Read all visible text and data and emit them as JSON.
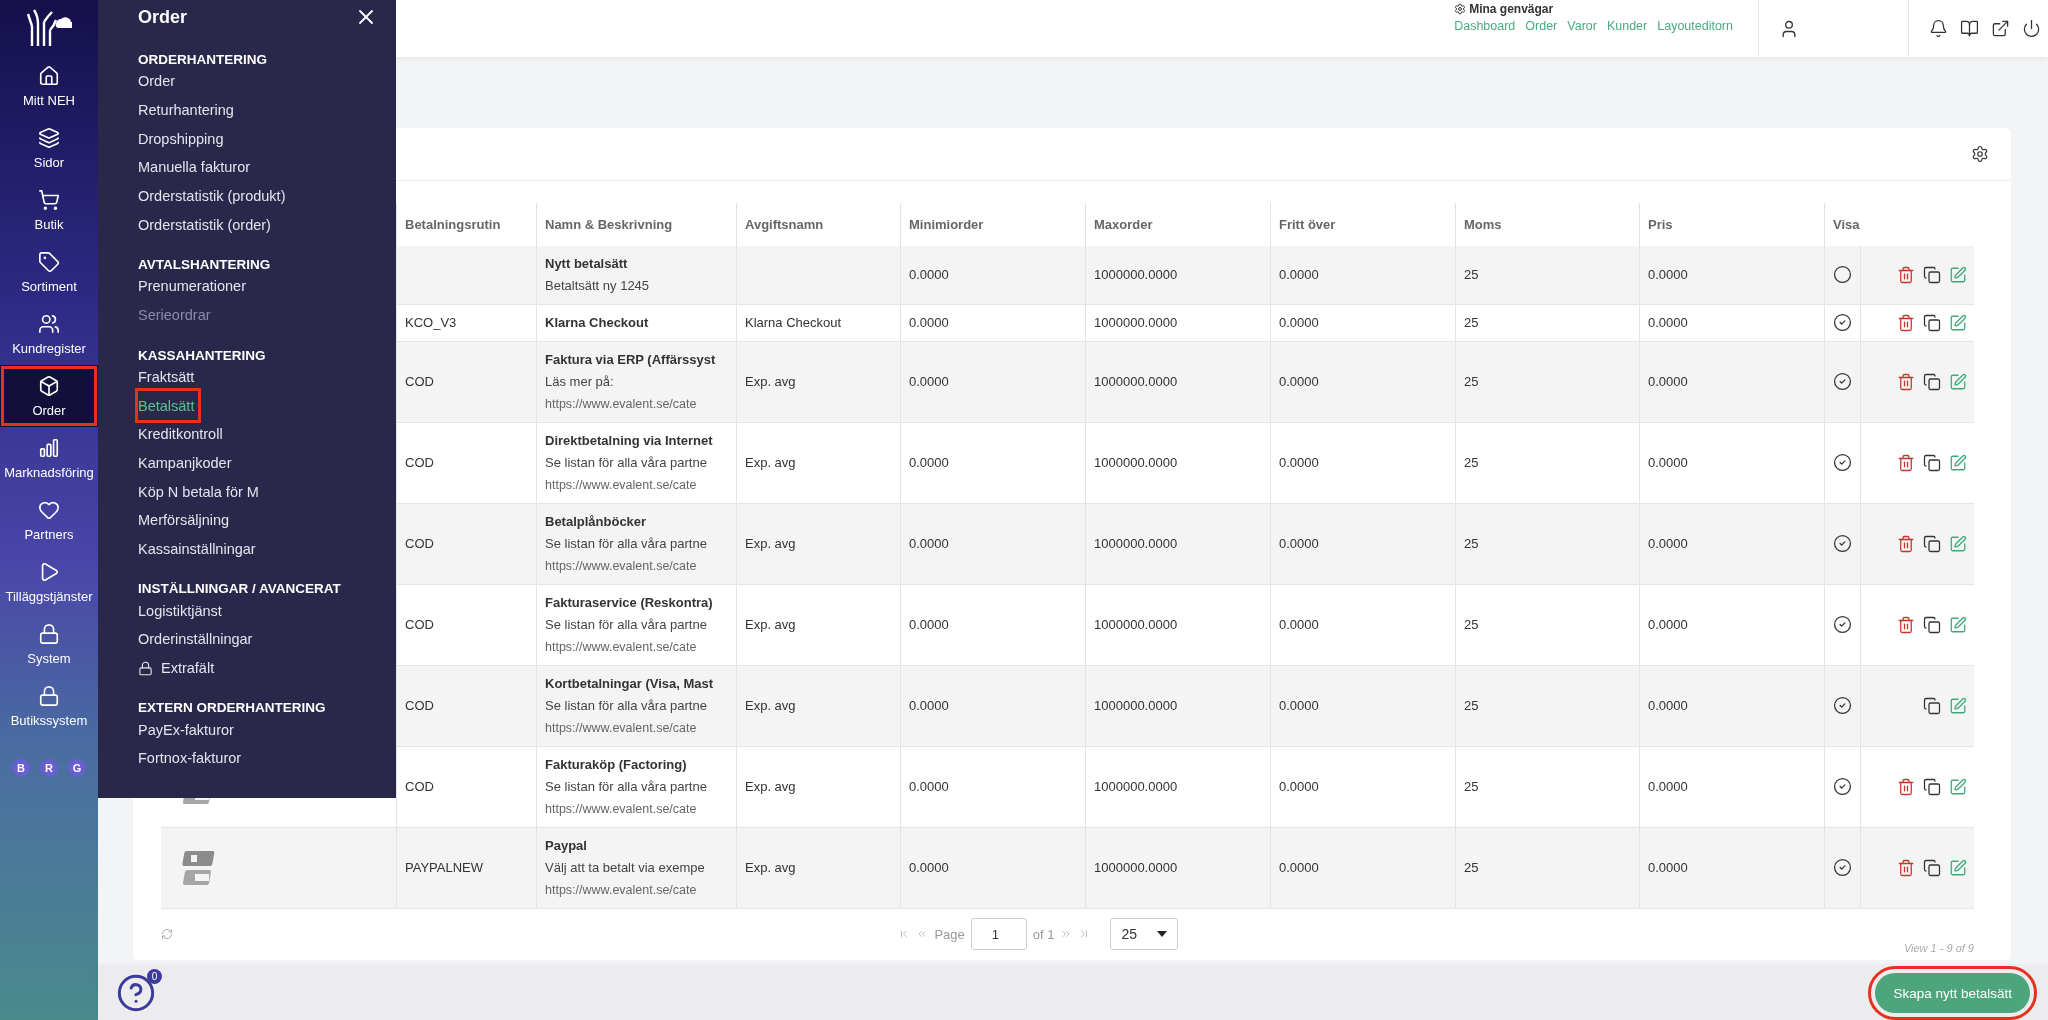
{
  "sidebar": {
    "items": [
      {
        "label": "Mitt NEH",
        "selected": false,
        "highlighted": false
      },
      {
        "label": "Sidor",
        "selected": false,
        "highlighted": false
      },
      {
        "label": "Butik",
        "selected": false,
        "highlighted": false
      },
      {
        "label": "Sortiment",
        "selected": false,
        "highlighted": false
      },
      {
        "label": "Kundregister",
        "selected": false,
        "highlighted": false
      },
      {
        "label": "Order",
        "selected": true,
        "highlighted": true
      },
      {
        "label": "Marknadsföring",
        "selected": false,
        "highlighted": false
      },
      {
        "label": "Partners",
        "selected": false,
        "highlighted": false
      },
      {
        "label": "Tilläggstjänster",
        "selected": false,
        "highlighted": false
      },
      {
        "label": "System",
        "selected": false,
        "highlighted": false
      },
      {
        "label": "Butikssystem",
        "selected": false,
        "highlighted": false
      }
    ],
    "avatars": [
      "B",
      "R",
      "G"
    ]
  },
  "header": {
    "shortcuts": {
      "title": "Mina genvägar",
      "links": [
        "Dashboard",
        "Order",
        "Varor",
        "Kunder",
        "Layouteditorn"
      ]
    }
  },
  "menu": {
    "title": "Order",
    "sections": [
      {
        "title": "ORDERHANTERING",
        "items": [
          {
            "label": "Order",
            "selected": false,
            "disabled": false,
            "locked": false,
            "highlighted": false
          },
          {
            "label": "Returhantering",
            "selected": false,
            "disabled": false,
            "locked": false,
            "highlighted": false
          },
          {
            "label": "Dropshipping",
            "selected": false,
            "disabled": false,
            "locked": false,
            "highlighted": false
          },
          {
            "label": "Manuella fakturor",
            "selected": false,
            "disabled": false,
            "locked": false,
            "highlighted": false
          },
          {
            "label": "Orderstatistik (produkt)",
            "selected": false,
            "disabled": false,
            "locked": false,
            "highlighted": false
          },
          {
            "label": "Orderstatistik (order)",
            "selected": false,
            "disabled": false,
            "locked": false,
            "highlighted": false
          }
        ]
      },
      {
        "title": "AVTALSHANTERING",
        "items": [
          {
            "label": "Prenumerationer",
            "selected": false,
            "disabled": false,
            "locked": false,
            "highlighted": false
          },
          {
            "label": "Serieordrar",
            "selected": false,
            "disabled": true,
            "locked": false,
            "highlighted": false
          }
        ]
      },
      {
        "title": "KASSAHANTERING",
        "items": [
          {
            "label": "Fraktsätt",
            "selected": false,
            "disabled": false,
            "locked": false,
            "highlighted": false
          },
          {
            "label": "Betalsätt",
            "selected": true,
            "disabled": false,
            "locked": false,
            "highlighted": true
          },
          {
            "label": "Kreditkontroll",
            "selected": false,
            "disabled": false,
            "locked": false,
            "highlighted": false
          },
          {
            "label": "Kampanjkoder",
            "selected": false,
            "disabled": false,
            "locked": false,
            "highlighted": false
          },
          {
            "label": "Köp N betala för M",
            "selected": false,
            "disabled": false,
            "locked": false,
            "highlighted": false
          },
          {
            "label": "Merförsäljning",
            "selected": false,
            "disabled": false,
            "locked": false,
            "highlighted": false
          },
          {
            "label": "Kassainställningar",
            "selected": false,
            "disabled": false,
            "locked": false,
            "highlighted": false
          }
        ]
      },
      {
        "title": "INSTÄLLNINGAR / AVANCERAT",
        "items": [
          {
            "label": "Logistiktjänst",
            "selected": false,
            "disabled": false,
            "locked": false,
            "highlighted": false
          },
          {
            "label": "Orderinställningar",
            "selected": false,
            "disabled": false,
            "locked": false,
            "highlighted": false
          },
          {
            "label": "Extrafält",
            "selected": false,
            "disabled": false,
            "locked": true,
            "highlighted": false
          }
        ]
      },
      {
        "title": "EXTERN ORDERHANTERING",
        "items": [
          {
            "label": "PayEx-fakturor",
            "selected": false,
            "disabled": false,
            "locked": false,
            "highlighted": false
          },
          {
            "label": "Fortnox-fakturor",
            "selected": false,
            "disabled": false,
            "locked": false,
            "highlighted": false
          }
        ]
      }
    ]
  },
  "table": {
    "columns": [
      "Betalningsrutin",
      "Namn & Beskrivning",
      "Avgiftsnamn",
      "Minimiorder",
      "Maxorder",
      "Fritt över",
      "Moms",
      "Pris",
      "Visa"
    ],
    "rows": [
      {
        "image": false,
        "routine": "",
        "name": "Nytt betalsätt",
        "lines": [
          "Betaltsätt ny 1245"
        ],
        "fee_name": "",
        "min": "0.0000",
        "max": "1000000.0000",
        "free_over": "0.0000",
        "vat": "25",
        "price": "0.0000",
        "visible": false,
        "deletable": true
      },
      {
        "image": false,
        "routine": "KCO_V3",
        "name": "Klarna Checkout",
        "lines": [],
        "fee_name": "Klarna Checkout",
        "min": "0.0000",
        "max": "1000000.0000",
        "free_over": "0.0000",
        "vat": "25",
        "price": "0.0000",
        "visible": true,
        "deletable": true
      },
      {
        "image": false,
        "routine": "COD",
        "name": "Faktura via ERP (Affärssyst",
        "lines": [
          "Läs mer på:",
          "https://www.evalent.se/cate"
        ],
        "fee_name": "Exp. avg",
        "min": "0.0000",
        "max": "1000000.0000",
        "free_over": "0.0000",
        "vat": "25",
        "price": "0.0000",
        "visible": true,
        "deletable": true
      },
      {
        "image": false,
        "routine": "COD",
        "name": "Direktbetalning via Internet",
        "lines": [
          "Se listan för alla våra partne",
          "https://www.evalent.se/cate"
        ],
        "fee_name": "Exp. avg",
        "min": "0.0000",
        "max": "1000000.0000",
        "free_over": "0.0000",
        "vat": "25",
        "price": "0.0000",
        "visible": true,
        "deletable": true
      },
      {
        "image": false,
        "routine": "COD",
        "name": "Betalplånböcker",
        "lines": [
          "Se listan för alla våra partne",
          "https://www.evalent.se/cate"
        ],
        "fee_name": "Exp. avg",
        "min": "0.0000",
        "max": "1000000.0000",
        "free_over": "0.0000",
        "vat": "25",
        "price": "0.0000",
        "visible": true,
        "deletable": true
      },
      {
        "image": false,
        "routine": "COD",
        "name": "Fakturaservice (Reskontra)",
        "lines": [
          "Se listan för alla våra partne",
          "https://www.evalent.se/cate"
        ],
        "fee_name": "Exp. avg",
        "min": "0.0000",
        "max": "1000000.0000",
        "free_over": "0.0000",
        "vat": "25",
        "price": "0.0000",
        "visible": true,
        "deletable": true
      },
      {
        "image": false,
        "routine": "COD",
        "name": "Kortbetalningar (Visa, Mast",
        "lines": [
          "Se listan för alla våra partne",
          "https://www.evalent.se/cate"
        ],
        "fee_name": "Exp. avg",
        "min": "0.0000",
        "max": "1000000.0000",
        "free_over": "0.0000",
        "vat": "25",
        "price": "0.0000",
        "visible": true,
        "deletable": false
      },
      {
        "image": true,
        "routine": "COD",
        "name": "Fakturaköp (Factoring)",
        "lines": [
          "Se listan för alla våra partne",
          "https://www.evalent.se/cate"
        ],
        "fee_name": "Exp. avg",
        "min": "0.0000",
        "max": "1000000.0000",
        "free_over": "0.0000",
        "vat": "25",
        "price": "0.0000",
        "visible": true,
        "deletable": true
      },
      {
        "image": true,
        "routine": "PAYPALNEW",
        "name": "Paypal",
        "lines": [
          "Välj att ta betalt via exempe",
          "https://www.evalent.se/cate"
        ],
        "fee_name": "Exp. avg",
        "min": "0.0000",
        "max": "1000000.0000",
        "free_over": "0.0000",
        "vat": "25",
        "price": "0.0000",
        "visible": true,
        "deletable": true
      }
    ]
  },
  "pagination": {
    "page_label": "Page",
    "page": "1",
    "of": "of 1",
    "page_size": "25",
    "summary": "View 1 - 9 of 9"
  },
  "help": {
    "badge": "0"
  },
  "create_button": {
    "label": "Skapa nytt betalsätt",
    "highlighted": true
  }
}
